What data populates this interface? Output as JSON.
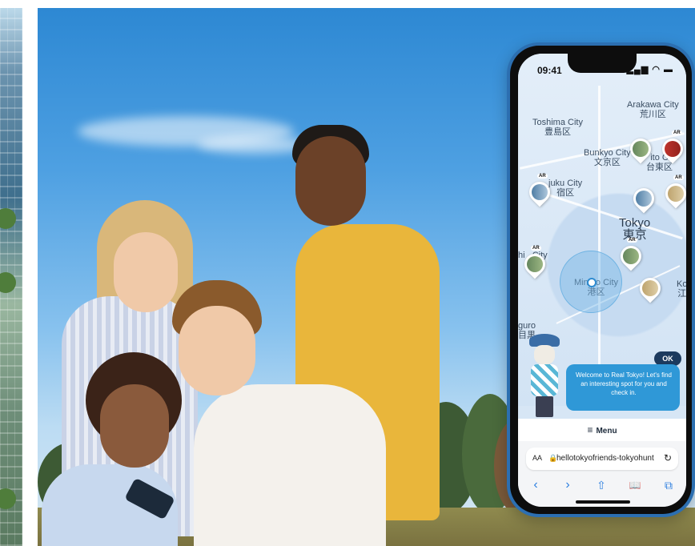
{
  "status": {
    "time": "09:41",
    "icons": "▂▄▆ ◠ ▬"
  },
  "map": {
    "districts": {
      "toshima": "Toshima City\n豊島区",
      "arakawa": "Arakawa City\n荒川区",
      "bunkyo": "Bunkyo City\n文京区",
      "taito": "ito C\n台東区",
      "shinjuku": "juku City\n宿区",
      "tokyo": "Tokyo\n東京",
      "shibuya": "hi   City",
      "minato": "Minato City\n港区",
      "meguro": "guro\n目黒",
      "ko": "Ko\n江"
    },
    "ar_label": "AR"
  },
  "chat": {
    "message": "Welcome to Real Tokyo! Let's find an interesting spot for you and check in.",
    "ok_label": "OK"
  },
  "menu": {
    "icon": "≡",
    "label": "Menu"
  },
  "browser": {
    "aa": "AA",
    "lock": "🔒",
    "url": "hellotokyofriends-tokyohunt",
    "reload": "↻",
    "nav": [
      "‹",
      "›",
      "⇧",
      "📖",
      "⧉"
    ]
  }
}
